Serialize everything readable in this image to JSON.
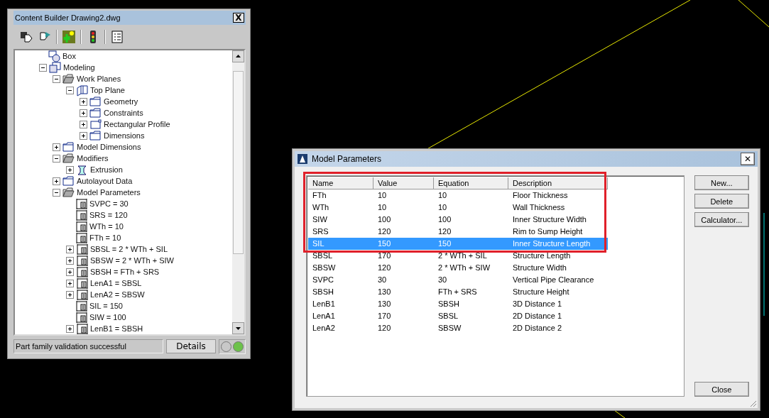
{
  "panel": {
    "title": "Content Builder Drawing2.dwg",
    "close": "X",
    "tree": [
      {
        "label": "Box",
        "kind": "shape"
      },
      {
        "label": "Modeling",
        "kind": "modeling",
        "expanded": true,
        "children": [
          {
            "label": "Work Planes",
            "kind": "folder-open",
            "expanded": true,
            "children": [
              {
                "label": "Top Plane",
                "kind": "plane",
                "expanded": true,
                "children": [
                  {
                    "label": "Geometry",
                    "kind": "folder",
                    "expanded": false
                  },
                  {
                    "label": "Constraints",
                    "kind": "folder",
                    "expanded": false
                  },
                  {
                    "label": "Rectangular Profile",
                    "kind": "profile",
                    "expanded": false
                  },
                  {
                    "label": "Dimensions",
                    "kind": "folder",
                    "expanded": false
                  }
                ]
              }
            ]
          },
          {
            "label": "Model Dimensions",
            "kind": "folder",
            "expanded": false
          },
          {
            "label": "Modifiers",
            "kind": "folder-open",
            "expanded": true,
            "children": [
              {
                "label": "Extrusion",
                "kind": "extrusion",
                "expanded": false
              }
            ]
          },
          {
            "label": "Autolayout Data",
            "kind": "folder",
            "expanded": false
          },
          {
            "label": "Model Parameters",
            "kind": "folder-open",
            "expanded": true,
            "children": [
              {
                "label": "SVPC = 30",
                "kind": "param"
              },
              {
                "label": "SRS = 120",
                "kind": "param"
              },
              {
                "label": "WTh = 10",
                "kind": "param"
              },
              {
                "label": "FTh = 10",
                "kind": "param"
              },
              {
                "label": "SBSL = 2 * WTh + SIL",
                "kind": "param",
                "expanded": false
              },
              {
                "label": "SBSW = 2 * WTh + SIW",
                "kind": "param",
                "expanded": false
              },
              {
                "label": "SBSH = FTh + SRS",
                "kind": "param",
                "expanded": false
              },
              {
                "label": "LenA1 = SBSL",
                "kind": "param",
                "expanded": false
              },
              {
                "label": "LenA2 = SBSW",
                "kind": "param",
                "expanded": false
              },
              {
                "label": "SIL = 150",
                "kind": "param"
              },
              {
                "label": "SIW = 100",
                "kind": "param"
              },
              {
                "label": "LenB1 = SBSH",
                "kind": "param",
                "expanded": false
              }
            ]
          }
        ]
      }
    ],
    "status": "Part family validation successful",
    "details_button": "Details",
    "indicators": [
      {
        "color": "#c8c8c8"
      },
      {
        "color": "#6cc24a"
      }
    ]
  },
  "dialog": {
    "title": "Model Parameters",
    "close": "✕",
    "columns": [
      "Name",
      "Value",
      "Equation",
      "Description"
    ],
    "rows": [
      {
        "cells": [
          "FTh",
          "10",
          "10",
          "Floor Thickness"
        ],
        "selected": false
      },
      {
        "cells": [
          "WTh",
          "10",
          "10",
          "Wall Thickness"
        ],
        "selected": false
      },
      {
        "cells": [
          "SIW",
          "100",
          "100",
          "Inner Structure Width"
        ],
        "selected": false
      },
      {
        "cells": [
          "SRS",
          "120",
          "120",
          "Rim to Sump Height"
        ],
        "selected": false
      },
      {
        "cells": [
          "SIL",
          "150",
          "150",
          "Inner Structure Length"
        ],
        "selected": true
      },
      {
        "cells": [
          "SBSL",
          "170",
          "2 * WTh + SIL",
          "Structure Length"
        ],
        "selected": false
      },
      {
        "cells": [
          "SBSW",
          "120",
          "2 * WTh + SIW",
          "Structure Width"
        ],
        "selected": false
      },
      {
        "cells": [
          "SVPC",
          "30",
          "30",
          "Vertical Pipe Clearance"
        ],
        "selected": false
      },
      {
        "cells": [
          "SBSH",
          "130",
          "FTh + SRS",
          "Structure Height"
        ],
        "selected": false
      },
      {
        "cells": [
          "LenB1",
          "130",
          "SBSH",
          "3D Distance 1"
        ],
        "selected": false
      },
      {
        "cells": [
          "LenA1",
          "170",
          "SBSL",
          "2D Distance 1"
        ],
        "selected": false
      },
      {
        "cells": [
          "LenA2",
          "120",
          "SBSW",
          "2D Distance 2"
        ],
        "selected": false
      }
    ],
    "buttons": [
      "New...",
      "Delete",
      "Calculator..."
    ],
    "close_button": "Close"
  }
}
